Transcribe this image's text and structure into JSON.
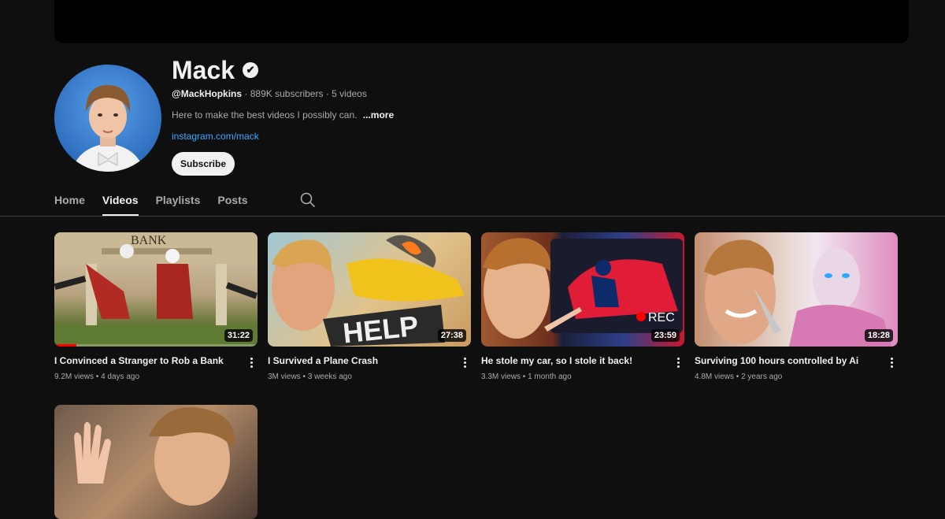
{
  "channel": {
    "name": "Mack",
    "handle": "@MackHopkins",
    "subscribers": "889K subscribers",
    "video_count": "5 videos",
    "separator": "·",
    "description": "Here to make the best videos I possibly can.",
    "more_label": "...more",
    "link": "instagram.com/mack",
    "subscribe_label": "Subscribe",
    "verified_icon": "✔"
  },
  "tabs": [
    {
      "label": "Home",
      "active": false
    },
    {
      "label": "Videos",
      "active": true
    },
    {
      "label": "Playlists",
      "active": false
    },
    {
      "label": "Posts",
      "active": false
    }
  ],
  "videos": [
    {
      "title": "I Convinced a Stranger to Rob a Bank",
      "views": "9.2M views",
      "age": "4 days ago",
      "duration": "31:22",
      "thumb_text": "BANK",
      "watched_fraction": 0.11
    },
    {
      "title": "I Survived a Plane Crash",
      "views": "3M views",
      "age": "3 weeks ago",
      "duration": "27:38",
      "thumb_text": "HELP"
    },
    {
      "title": "He stole my car, so I stole it back!",
      "views": "3.3M views",
      "age": "1 month ago",
      "duration": "23:59",
      "thumb_text": "REC"
    },
    {
      "title": "Surviving 100 hours controlled by Ai",
      "views": "4.8M views",
      "age": "2 years ago",
      "duration": "18:28"
    },
    {
      "title": "",
      "views": "",
      "age": "",
      "duration": ""
    }
  ],
  "colors": {
    "accent_link": "#3ea6ff",
    "background": "#0f0f0f",
    "progress": "#ff0000"
  }
}
